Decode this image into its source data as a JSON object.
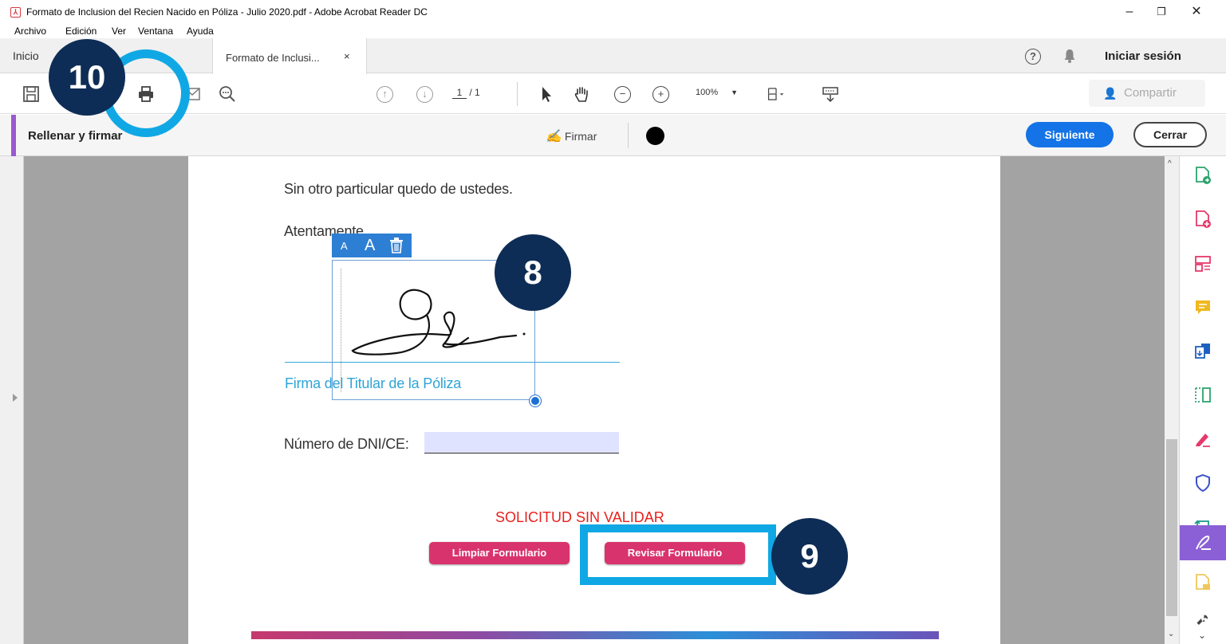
{
  "window": {
    "title": "Formato de Inclusion del Recien Nacido en Póliza - Julio 2020.pdf - Adobe Acrobat Reader DC",
    "min": "–",
    "max": "❐",
    "close": "✕"
  },
  "menu": {
    "file": "Archivo",
    "edit": "Edición",
    "view": "Ver",
    "window": "Ventana",
    "help": "Ayuda"
  },
  "tabs": {
    "home": "Inicio",
    "doc": "Formato de Inclusi...",
    "doc_close": "×",
    "help_glyph": "?",
    "signin": "Iniciar sesión"
  },
  "toolbar": {
    "page_current": "1",
    "page_total": "/ 1",
    "zoom": "100%",
    "share": "Compartir"
  },
  "fillsign": {
    "title": "Rellenar y firmar",
    "sign": "Firmar",
    "next": "Siguiente",
    "close": "Cerrar",
    "ink_color": "#000000"
  },
  "document": {
    "closing": "Sin otro particular quedo de ustedes.",
    "regards": "Atentamente",
    "sig_label": "Firma del Titular de la Póliza",
    "dni_label": "Número de DNI/CE:",
    "dni_value": "",
    "status": "SOLICITUD SIN VALIDAR",
    "btn_clear": "Limpiar Formulario",
    "btn_review": "Revisar Formulario"
  },
  "sig_tools": {
    "small": "A",
    "large": "A",
    "delete_icon": "trash-icon"
  },
  "annotations": {
    "callout_8": "8",
    "callout_9": "9",
    "callout_10": "10"
  },
  "colors": {
    "accent_blue": "#1473e6",
    "callout_navy": "#0e2d56",
    "callout_ring": "#10a8e4",
    "form_button": "#d9336d",
    "status_red": "#e8201c",
    "fill_sign_purple": "#9b59d0"
  }
}
